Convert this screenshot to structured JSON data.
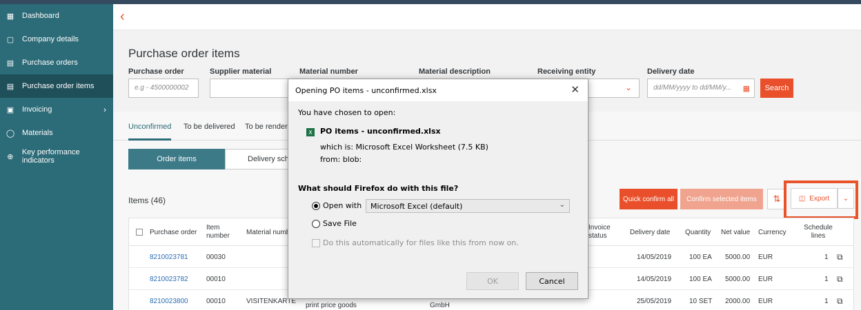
{
  "colors": {
    "accent": "#e94f2a",
    "sidebar": "#2c6b78",
    "link": "#2a6cb3",
    "highlight": "#e8532a"
  },
  "sidebar": {
    "items": [
      {
        "label": "Dashboard",
        "icon": "dashboard-icon"
      },
      {
        "label": "Company details",
        "icon": "building-icon"
      },
      {
        "label": "Purchase orders",
        "icon": "document-icon"
      },
      {
        "label": "Purchase order items",
        "icon": "list-icon"
      },
      {
        "label": "Invoicing",
        "icon": "invoice-icon"
      },
      {
        "label": "Materials",
        "icon": "materials-icon"
      },
      {
        "label": "Key performance indicators",
        "icon": "kpi-icon"
      }
    ]
  },
  "page": {
    "title": "Purchase order items"
  },
  "filters": {
    "purchase_order_label": "Purchase order",
    "purchase_order_placeholder": "e.g - 4500000002",
    "supplier_material_label": "Supplier material",
    "material_number_label": "Material number",
    "material_description_label": "Material description",
    "receiving_entity_label": "Receiving entity",
    "delivery_date_label": "Delivery date",
    "delivery_date_placeholder": "dd/MM/yyyy to dd/MM/y...",
    "search_label": "Search"
  },
  "tabs": [
    "Unconfirmed",
    "To be delivered",
    "To be rendered"
  ],
  "segments": [
    "Order items",
    "Delivery schedules"
  ],
  "toolbar": {
    "items_count": "Items (46)",
    "quick_confirm": "Quick confirm all",
    "confirm_selected": "Confirm selected items",
    "export": "Export"
  },
  "table": {
    "headers": {
      "purchase_order": "Purchase order",
      "item_number": "Item number",
      "material_number": "Material numb",
      "invoice_status": "Invoice status",
      "delivery_date": "Delivery date",
      "quantity": "Quantity",
      "net_value": "Net value",
      "currency": "Currency",
      "schedule_lines": "Schedule lines"
    },
    "rows": [
      {
        "po": "8210023781",
        "item": "00030",
        "material": "",
        "description": "",
        "supplier": "",
        "delivery": "14/05/2019",
        "qty": "100 EA",
        "net": "5000.00",
        "currency": "EUR",
        "lines": "1"
      },
      {
        "po": "8210023782",
        "item": "00010",
        "material": "",
        "description": "",
        "supplier": "",
        "delivery": "14/05/2019",
        "qty": "100 EA",
        "net": "5000.00",
        "currency": "EUR",
        "lines": "1"
      },
      {
        "po": "8210023800",
        "item": "00010",
        "material": "VISITENKARTE",
        "description": "print price goods",
        "supplier": "GmbH",
        "delivery": "25/05/2019",
        "qty": "10 SET",
        "net": "2000.00",
        "currency": "EUR",
        "lines": "1"
      }
    ]
  },
  "dialog": {
    "title": "Opening PO items - unconfirmed.xlsx",
    "chosen": "You have chosen to open:",
    "filename": "PO items - unconfirmed.xlsx",
    "which_is": "which is: Microsoft Excel Worksheet (7.5 KB)",
    "from": "from: blob:",
    "question": "What should Firefox do with this file?",
    "open_with": "Open with",
    "app": "Microsoft Excel (default)",
    "save_file": "Save File",
    "auto": "Do this automatically for files like this from now on.",
    "ok": "OK",
    "cancel": "Cancel"
  }
}
